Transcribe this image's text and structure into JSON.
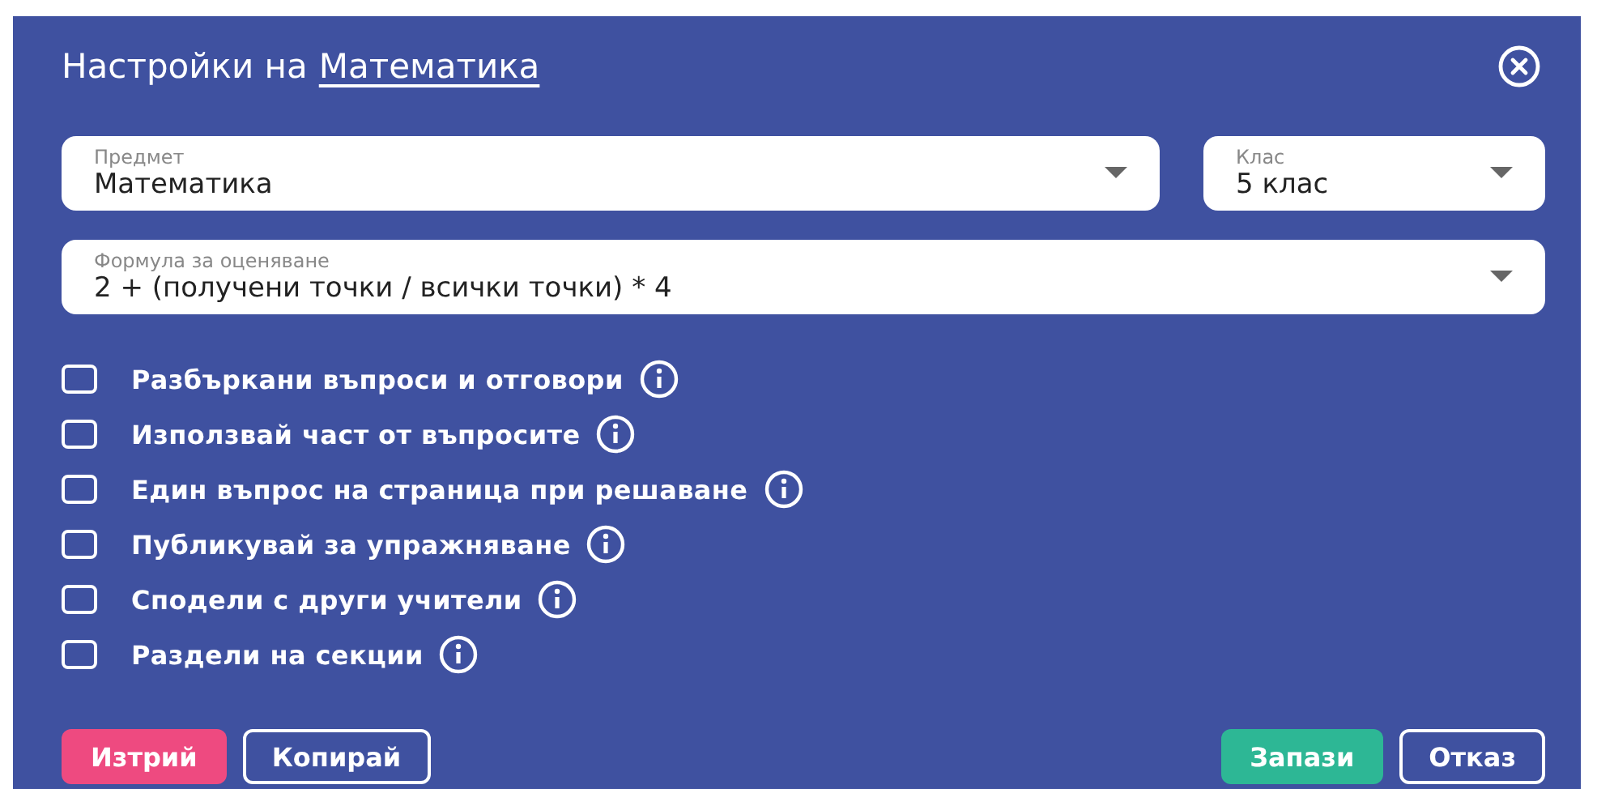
{
  "dialog": {
    "title": "Настройки на",
    "title_link": "Математика"
  },
  "fields": [
    {
      "label": "Предмет",
      "value": "Математика"
    },
    {
      "label": "Клас",
      "value": "5 клас"
    },
    {
      "label": "Формула за оценяване",
      "value": "2 + (получени точки / всички точки) * 4"
    }
  ],
  "options": [
    {
      "label": "Разбъркани въпроси и отговори",
      "checked": false
    },
    {
      "label": "Използвай част от въпросите",
      "checked": false
    },
    {
      "label": "Един въпрос на страница при решаване",
      "checked": false
    },
    {
      "label": "Публикувай за упражняване",
      "checked": false
    },
    {
      "label": "Сподели с други учители",
      "checked": false
    },
    {
      "label": "Раздели на секции",
      "checked": false
    }
  ],
  "buttons": [
    {
      "label": "Изтрий",
      "kind": "danger"
    },
    {
      "label": "Копирай",
      "kind": "outline"
    },
    {
      "label": "Запази",
      "kind": "primary"
    },
    {
      "label": "Отказ",
      "kind": "outline"
    }
  ]
}
